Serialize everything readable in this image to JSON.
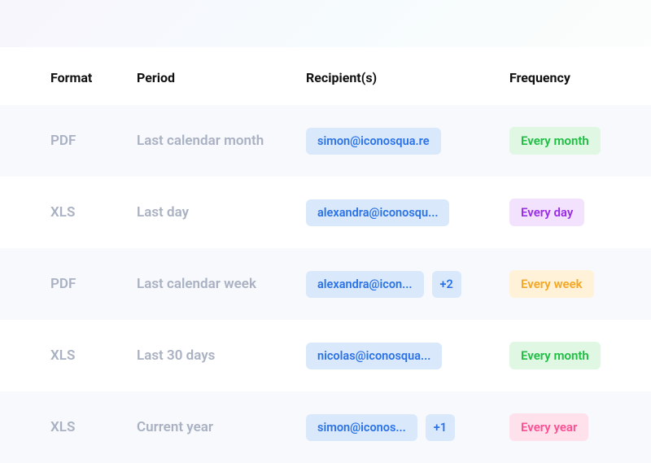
{
  "columns": {
    "format": "Format",
    "period": "Period",
    "recipients": "Recipient(s)",
    "frequency": "Frequency"
  },
  "rows": [
    {
      "format": "PDF",
      "period": "Last calendar month",
      "recipient": "simon@iconosqua.re",
      "more": null,
      "frequency": "Every month",
      "frequency_class": "freq-month"
    },
    {
      "format": "XLS",
      "period": "Last day",
      "recipient": "alexandra@iconosqu...",
      "more": null,
      "frequency": "Every day",
      "frequency_class": "freq-day"
    },
    {
      "format": "PDF",
      "period": "Last calendar week",
      "recipient": "alexandra@icon...",
      "more": "+2",
      "frequency": "Every week",
      "frequency_class": "freq-week"
    },
    {
      "format": "XLS",
      "period": "Last 30 days",
      "recipient": "nicolas@iconosqua...",
      "more": null,
      "frequency": "Every month",
      "frequency_class": "freq-month"
    },
    {
      "format": "XLS",
      "period": "Current year",
      "recipient": "simon@iconos...",
      "more": "+1",
      "frequency": "Every year",
      "frequency_class": "freq-year"
    }
  ]
}
